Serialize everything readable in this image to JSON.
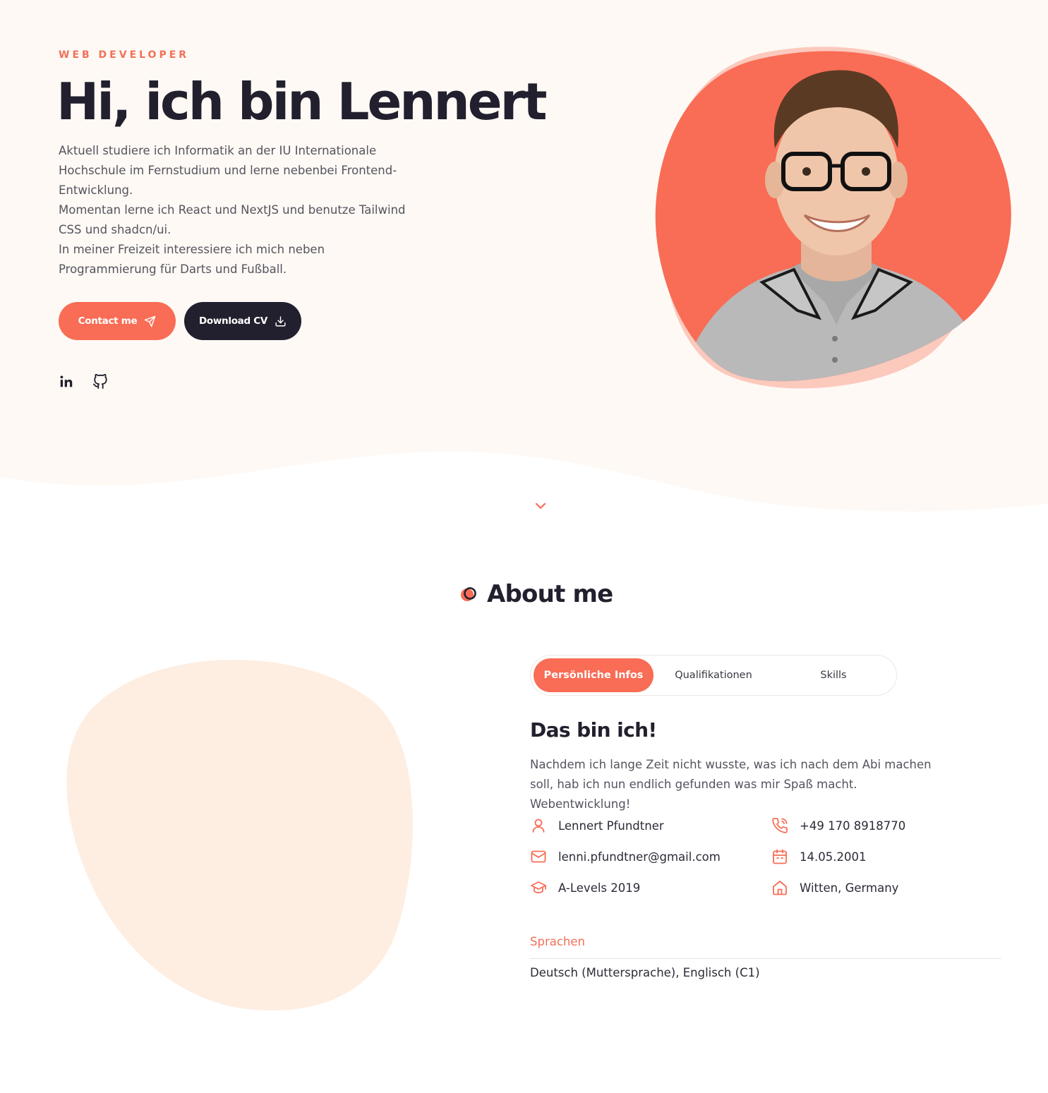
{
  "colors": {
    "accent": "#f96c55",
    "accent_light": "#fcc9bd",
    "dark": "#22202e",
    "hero_bg": "#fef9f4",
    "blob_peach": "#feeee2"
  },
  "hero": {
    "eyebrow": "WEB DEVELOPER",
    "title": "Hi, ich bin Lennert",
    "description_lines": [
      "Aktuell studiere ich Informatik an der IU Internationale Hochschule im Fernstudium und lerne nebenbei Frontend-Entwicklung.",
      "Momentan lerne ich React und NextJS und benutze Tailwind CSS und shadcn/ui.",
      "In meiner Freizeit interessiere ich mich neben Programmierung für Darts und Fußball."
    ],
    "contact_button": "Contact me",
    "cv_button": "Download CV",
    "socials": [
      {
        "icon": "linkedin-icon"
      },
      {
        "icon": "github-icon"
      }
    ],
    "photo": {
      "icon": "portrait-photo"
    }
  },
  "about": {
    "title": "About me",
    "tabs": [
      "Persönliche Infos",
      "Qualifikationen",
      "Skills"
    ],
    "active_tab": "Persönliche Infos",
    "heading": "Das bin ich!",
    "description": "Nachdem ich lange Zeit nicht wusste, was ich nach dem Abi machen soll, hab ich nun endlich gefunden was mir Spaß macht. Webentwicklung!",
    "info": {
      "name": {
        "icon": "user-icon",
        "value": "Lennert Pfundtner"
      },
      "phone": {
        "icon": "phone-icon",
        "value": "+49 170 8918770"
      },
      "email": {
        "icon": "mail-icon",
        "value": "lenni.pfundtner@gmail.com"
      },
      "birthday": {
        "icon": "calendar-icon",
        "value": "14.05.2001"
      },
      "education": {
        "icon": "graduation-cap-icon",
        "value": "A-Levels 2019"
      },
      "location": {
        "icon": "home-icon",
        "value": "Witten, Germany"
      }
    },
    "languages_label": "Sprachen",
    "languages_value": "Deutsch (Muttersprache), Englisch (C1)"
  }
}
